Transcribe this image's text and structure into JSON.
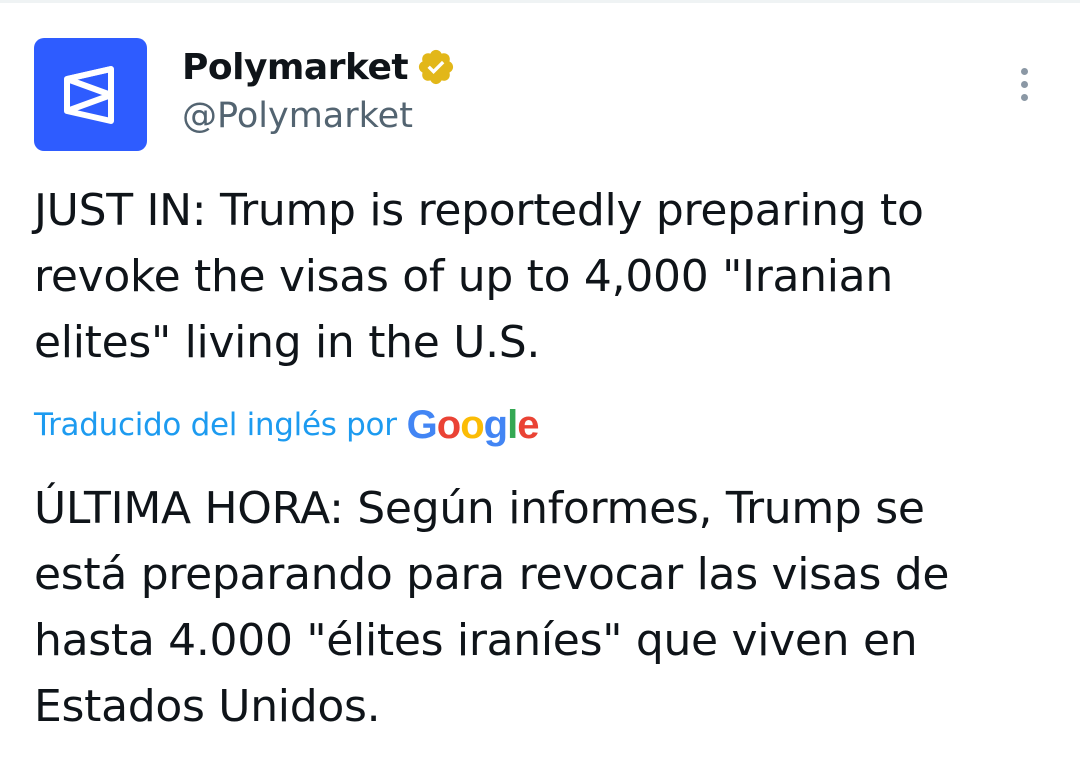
{
  "tweet": {
    "author": {
      "display_name": "Polymarket",
      "handle": "@Polymarket",
      "verified": true,
      "verified_badge_color": "#e2b719",
      "avatar_color": "#2e5cff",
      "avatar_icon": "polymarket-logo-icon"
    },
    "more_icon": "more-vertical-icon",
    "text_lines": [
      "JUST IN: Trump is reportedly preparing to",
      "revoke the visas of up to 4,000 \"Iranian",
      "elites\" living in the U.S."
    ],
    "translation": {
      "label": "Traducido del inglés por",
      "provider": "Google",
      "provider_letters": [
        "G",
        "o",
        "o",
        "g",
        "l",
        "e"
      ],
      "text_lines": [
        "ÚLTIMA HORA: Según informes, Trump se",
        "está preparando para revocar las visas de",
        "hasta 4.000 \"élites iraníes\" que viven en",
        "Estados Unidos."
      ]
    }
  },
  "colors": {
    "link_blue": "#1d9bf0",
    "text_primary": "#0f1419",
    "text_secondary": "#536471"
  }
}
